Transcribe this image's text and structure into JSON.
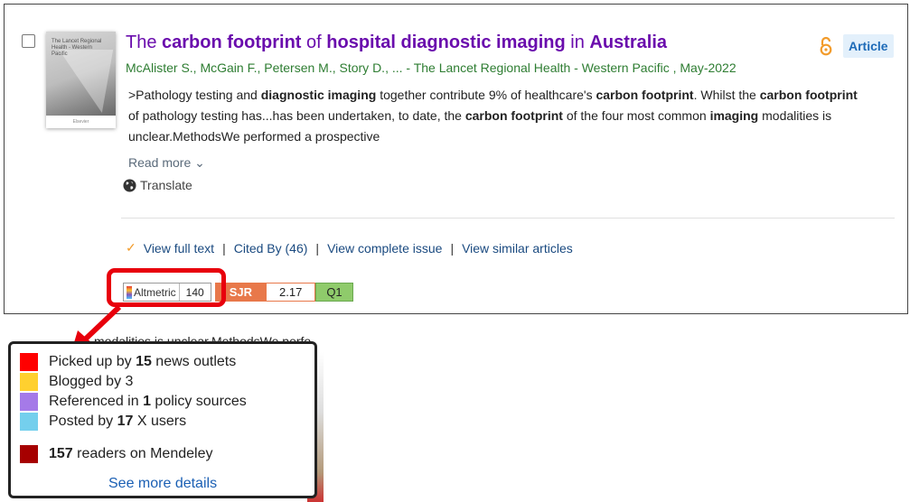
{
  "article": {
    "title_parts": [
      {
        "text": "The ",
        "bold": false
      },
      {
        "text": "carbon footprint",
        "bold": true
      },
      {
        "text": " of ",
        "bold": false
      },
      {
        "text": "hospital diagnostic imaging",
        "bold": true
      },
      {
        "text": " in ",
        "bold": false
      },
      {
        "text": "Australia",
        "bold": true
      }
    ],
    "type_badge": "Article",
    "authors": "McAlister S., McGain F., Petersen M., Story D., ...  - The Lancet Regional Health - Western Pacific , May-2022",
    "cover_title": "The Lancet Regional Health - Western Pacific",
    "cover_publisher": "Elsevier",
    "abstract_parts": [
      {
        "text": ">Pathology testing and ",
        "bold": false
      },
      {
        "text": "diagnostic imaging",
        "bold": true
      },
      {
        "text": " together contribute 9% of healthcare's ",
        "bold": false
      },
      {
        "text": "carbon footprint",
        "bold": true
      },
      {
        "text": ". Whilst the ",
        "bold": false
      },
      {
        "text": "carbon footprint",
        "bold": true
      },
      {
        "text": " of pathology testing has...has been undertaken, to date, the ",
        "bold": false
      },
      {
        "text": "carbon footprint",
        "bold": true
      },
      {
        "text": " of the four most common ",
        "bold": false
      },
      {
        "text": "imaging",
        "bold": true
      },
      {
        "text": " modalities is unclear.MethodsWe performed a prospective",
        "bold": false
      }
    ],
    "read_more": "Read more",
    "translate": "Translate"
  },
  "links": {
    "view_full_text": "View full text",
    "cited_by": "Cited By (46)",
    "view_complete_issue": "View complete issue",
    "view_similar": "View similar articles",
    "separator": "|"
  },
  "metrics": {
    "altmetric_label": "Altmetric",
    "altmetric_score": "140",
    "sjr_label": "SJR",
    "sjr_value": "2.17",
    "quartile": "Q1"
  },
  "background_text": "modalities is unclear.MethodsWe perfo",
  "popup": {
    "items": [
      {
        "parts": [
          {
            "text": "Picked up by ",
            "bold": false
          },
          {
            "text": "15",
            "bold": true
          },
          {
            "text": " news outlets",
            "bold": false
          }
        ],
        "color": "#ff0000"
      },
      {
        "parts": [
          {
            "text": "Blogged by 3",
            "bold": false
          }
        ],
        "color": "#ffd02f"
      },
      {
        "parts": [
          {
            "text": "Referenced in ",
            "bold": false
          },
          {
            "text": "1",
            "bold": true
          },
          {
            "text": " policy sources",
            "bold": false
          }
        ],
        "color": "#a57ae8"
      },
      {
        "parts": [
          {
            "text": "Posted by ",
            "bold": false
          },
          {
            "text": "17",
            "bold": true
          },
          {
            "text": " X users",
            "bold": false
          }
        ],
        "color": "#74cfed"
      },
      {
        "parts": [
          {
            "text": "157",
            "bold": true
          },
          {
            "text": " readers on Mendeley",
            "bold": false
          }
        ],
        "color": "#a60000"
      }
    ],
    "see_more": "See more details"
  },
  "colors": {
    "title": "#6a0dad",
    "authors": "#2e7d32",
    "link": "#1a4a80",
    "highlight": "#e8000c",
    "sjr": "#e8784a",
    "quartile": "#8fcb6b"
  },
  "icons": {
    "open_access": "open-access-lock-icon",
    "globe": "globe-icon",
    "check": "check-icon",
    "chevron": "chevron-down-icon",
    "arrow": "red-pointer-arrow"
  }
}
